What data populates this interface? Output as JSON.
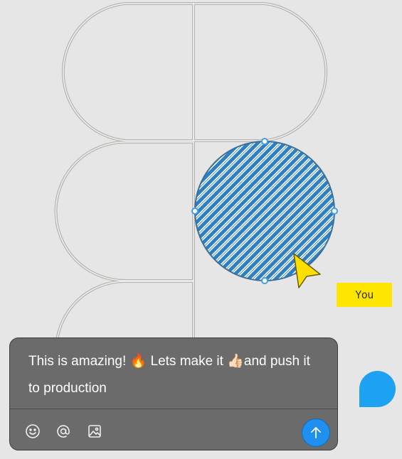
{
  "canvas": {
    "logo_stroke_color": "#b9b5b0",
    "selected_shape_fill": "#2f7fc0",
    "selection_handle_color": "#3fa0e8",
    "cursor_color": "#ffde00"
  },
  "multiplayer": {
    "cursor_label": "You",
    "cursor_label_color": "#ffe600",
    "collaborator_avatar_color": "#1da1f2"
  },
  "comment": {
    "text_part1": "This is amazing! ",
    "fire_emoji": "🔥",
    "text_part2": " Lets make it ",
    "thumbs_emoji": "👍🏻",
    "text_part3": "and push it to production"
  },
  "toolbar": {
    "icons": [
      "emoji-icon",
      "mention-icon",
      "image-icon"
    ],
    "send_color": "#1f8ff0"
  }
}
